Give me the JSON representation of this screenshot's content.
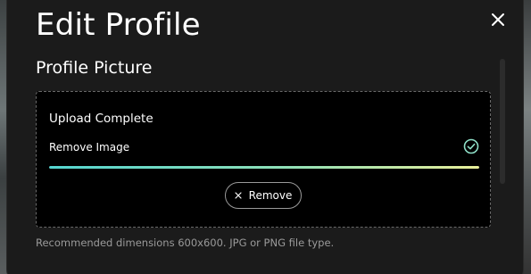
{
  "dialog": {
    "title": "Edit Profile",
    "close_icon": "close-icon"
  },
  "section": {
    "title": "Profile Picture"
  },
  "upload": {
    "status": "Upload Complete",
    "file_label": "Remove Image",
    "progress": 1.0,
    "status_icon": "check-circle-icon",
    "remove_button_label": "Remove",
    "remove_icon": "x-icon"
  },
  "hint": "Recommended dimensions 600x600. JPG or PNG file type.",
  "colors": {
    "modal_bg": "#1b1b1b",
    "upload_bg": "#000000",
    "accent": "#54d5d0",
    "progress_end": "#e9ef9a",
    "hint_text": "#9a9a9a"
  }
}
